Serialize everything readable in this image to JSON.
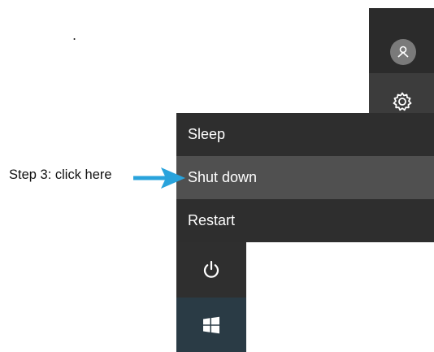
{
  "stray_mark": ".",
  "account": {
    "icon": "user-avatar-icon"
  },
  "settings": {
    "icon": "gear-icon"
  },
  "power_menu": {
    "items": [
      {
        "label": "Sleep",
        "state": "normal"
      },
      {
        "label": "Shut down",
        "state": "hovered"
      },
      {
        "label": "Restart",
        "state": "normal"
      }
    ],
    "hover_color": "#505050",
    "background_color": "#2e2e2e"
  },
  "power_button": {
    "icon": "power-icon"
  },
  "start_button": {
    "icon": "windows-logo-icon",
    "background_color": "#2a3b45"
  },
  "annotation": {
    "label": "Step 3: click here",
    "arrow_color": "#29a3dc"
  }
}
